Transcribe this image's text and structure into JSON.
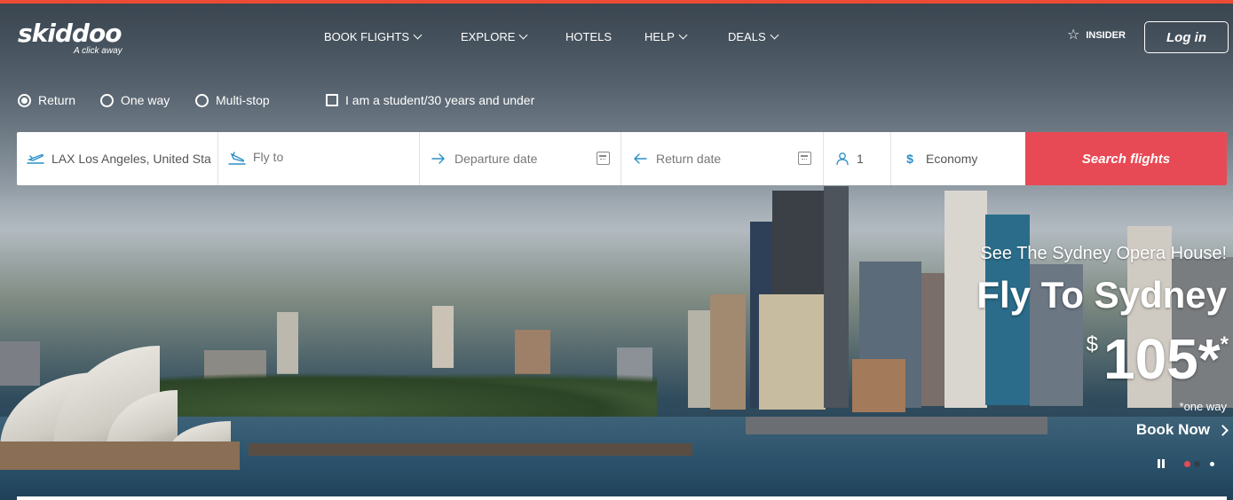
{
  "brand": {
    "name": "skiddoo",
    "tagline": "A click away",
    "accent_color": "#ee4b37"
  },
  "nav": {
    "items": [
      {
        "label": "BOOK FLIGHTS",
        "has_dropdown": true
      },
      {
        "label": "EXPLORE",
        "has_dropdown": true
      },
      {
        "label": "HOTELS",
        "has_dropdown": false
      },
      {
        "label": "HELP",
        "has_dropdown": true
      },
      {
        "label": "DEALS",
        "has_dropdown": true
      }
    ],
    "insider_label": "INSIDER",
    "login_label": "Log in"
  },
  "trip_options": {
    "types": [
      {
        "label": "Return",
        "selected": true
      },
      {
        "label": "One way",
        "selected": false
      },
      {
        "label": "Multi-stop",
        "selected": false
      }
    ],
    "student_label": "I am a student/30 years and under",
    "student_checked": false
  },
  "search": {
    "from_value": "LAX Los Angeles, United States",
    "to_placeholder": "Fly to",
    "departure_placeholder": "Departure date",
    "return_placeholder": "Return date",
    "passengers": "1",
    "cabin_class": "Economy",
    "button_label": "Search flights",
    "button_color": "#e84a55",
    "icon_color": "#2a8fc7"
  },
  "promo": {
    "subtitle": "See The Sydney Opera House!",
    "title": "Fly To Sydney",
    "currency": "$",
    "price": "105*",
    "asterisk": "*",
    "note": "*one way",
    "cta": "Book Now"
  },
  "carousel": {
    "active_color": "#e84a55"
  }
}
